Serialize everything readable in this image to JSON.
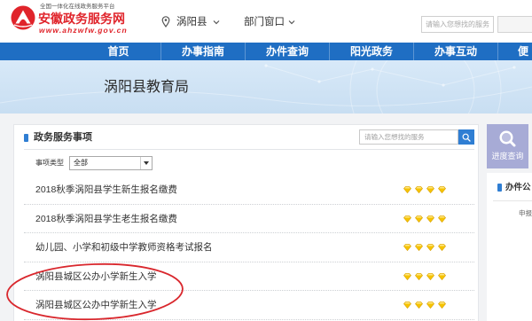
{
  "header": {
    "logo": {
      "icon": "ahzwfw-logo",
      "platform_text": "全国一体化在线政务服务平台",
      "site_name": "安徽政务服务网",
      "url_text": "www.ahzwfw.gov.cn"
    },
    "location": {
      "icon": "location-pin-icon",
      "value": "涡阳县",
      "dropdown_icon": "chevron-down-icon"
    },
    "department_window": {
      "label": "部门窗口",
      "dropdown_icon": "chevron-down-icon"
    },
    "search": {
      "placeholder": "请输入您想找的服务"
    }
  },
  "nav": {
    "items": [
      {
        "label": "首页"
      },
      {
        "label": "办事指南"
      },
      {
        "label": "办件查询"
      },
      {
        "label": "阳光政务"
      },
      {
        "label": "办事互动"
      },
      {
        "label": "便"
      }
    ]
  },
  "banner": {
    "title": "涡阳县教育局"
  },
  "services": {
    "title": "政务服务事项",
    "search": {
      "placeholder": "请输入您想找的服务",
      "icon": "search-icon"
    },
    "filter": {
      "label": "事项类型",
      "selected": "全部"
    },
    "items": [
      {
        "label": "2018秋季涡阳县学生新生报名缴费",
        "stars": 4
      },
      {
        "label": "2018秋季涡阳县学生老生报名缴费",
        "stars": 4
      },
      {
        "label": "幼儿园、小学和初级中学教师资格考试报名",
        "stars": 4
      },
      {
        "label": "涡阳县城区公办小学新生入学",
        "stars": 4
      },
      {
        "label": "涡阳县城区公办中学新生入学",
        "stars": 4
      }
    ]
  },
  "sidebar": {
    "progress_query": {
      "label": "进度查询",
      "icon": "search-icon"
    },
    "public_notice": {
      "title": "办件公",
      "column_label": "申报"
    }
  },
  "colors": {
    "brand_red": "#e0242b",
    "nav_blue": "#1f6ec3",
    "accent_blue": "#2f7ed3",
    "rating_gold": "#f6c300",
    "progress_purple": "#a7abd6",
    "annotation_red": "#d9272d"
  }
}
